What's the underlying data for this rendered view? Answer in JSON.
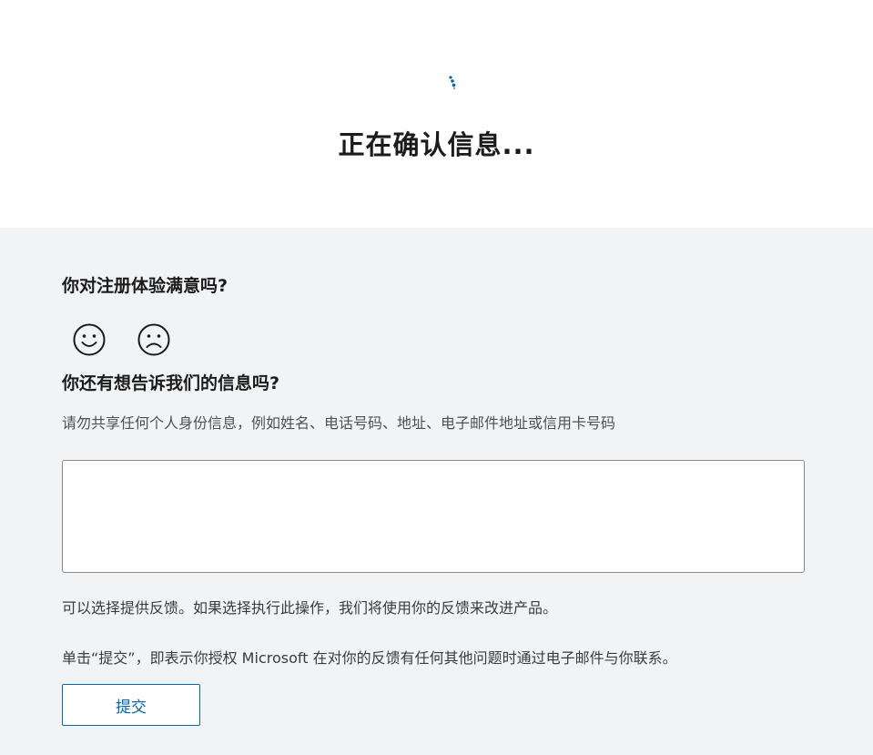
{
  "status": {
    "title": "正在确认信息...",
    "spinner_icon": "loading-spinner-icon",
    "spinner_color": "#0067b8"
  },
  "feedback": {
    "question_satisfaction": "你对注册体验满意吗?",
    "happy_icon": "smiley-face-icon",
    "sad_icon": "frowning-face-icon",
    "question_more": "你还有想告诉我们的信息吗?",
    "privacy_hint": "请勿共享任何个人身份信息，例如姓名、电话号码、地址、电子邮件地址或信用卡号码",
    "textarea_value": "",
    "optional_note": "可以选择提供反馈。如果选择执行此操作，我们将使用你的反馈来改进产品。",
    "consent_note": "单击“提交”，即表示你授权 Microsoft 在对你的反馈有任何其他问题时通过电子邮件与你联系。",
    "submit_label": "提交"
  },
  "colors": {
    "accent": "#0067b8",
    "panel_background": "#f2f3f5"
  }
}
